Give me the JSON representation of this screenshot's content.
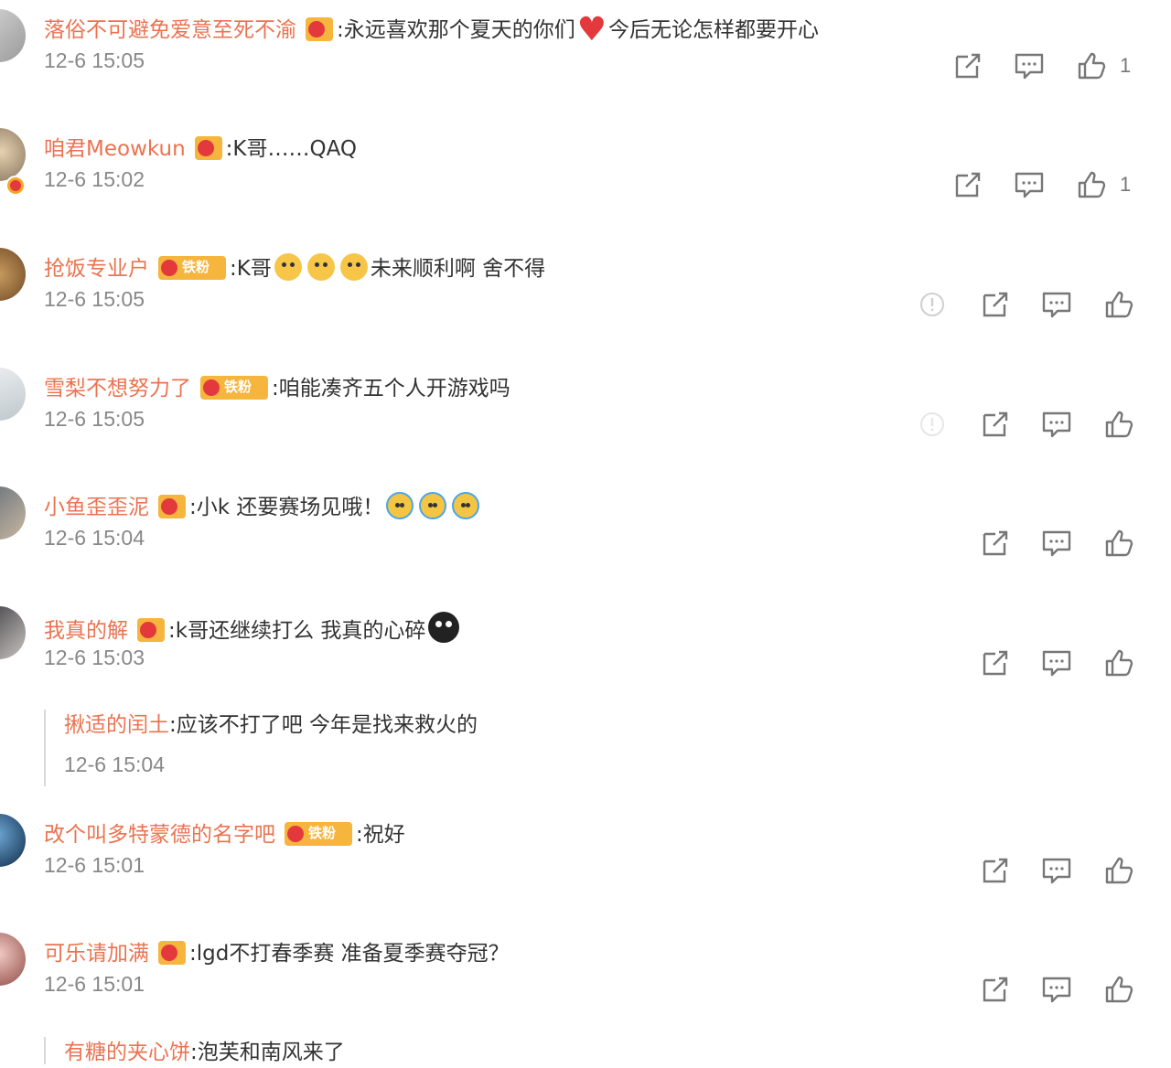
{
  "colors": {
    "username": "#eb7350",
    "text": "#333333",
    "timestamp": "#888888",
    "icon": "#777777",
    "badge": "#f6b53d"
  },
  "badges": {
    "fan_badge_text": "铁粉"
  },
  "comments": [
    {
      "username": "落俗不可避免爱意至死不渝",
      "text_before": ":永远喜欢那个夏天的你们",
      "text_after": "今后无论怎样都要开心",
      "time": "12-6 15:05",
      "likes": "1",
      "badge": "small",
      "icons": [
        "share-icon",
        "comment-icon",
        "like-icon"
      ]
    },
    {
      "username": "咱君Meowkun",
      "text_before": ":K哥……QAQ",
      "time": "12-6 15:02",
      "likes": "1",
      "badge": "small",
      "verified": true,
      "icons": [
        "share-icon",
        "comment-icon",
        "like-icon"
      ]
    },
    {
      "username": "抢饭专业户",
      "text_before": ":K哥",
      "text_after": "未来顺利啊 舍不得",
      "time": "12-6 15:05",
      "badge": "big",
      "icons": [
        "report-icon",
        "share-icon",
        "comment-icon",
        "like-icon"
      ]
    },
    {
      "username": "雪梨不想努力了",
      "text_before": ":咱能凑齐五个人开游戏吗",
      "time": "12-6 15:05",
      "badge": "big",
      "icons": [
        "report-icon",
        "share-icon",
        "comment-icon",
        "like-icon"
      ]
    },
    {
      "username": "小鱼歪歪泥",
      "text_before": ":小k 还要赛场见哦！",
      "time": "12-6 15:04",
      "badge": "small",
      "icons": [
        "share-icon",
        "comment-icon",
        "like-icon"
      ]
    },
    {
      "username": "我真的解",
      "text_before": ":k哥还继续打么 我真的心碎",
      "time": "12-6 15:03",
      "badge": "small",
      "icons": [
        "share-icon",
        "comment-icon",
        "like-icon"
      ],
      "reply": {
        "username": "揪适的闰土",
        "text": ":应该不打了吧 今年是找来救火的",
        "time": "12-6 15:04"
      }
    },
    {
      "username": "改个叫多特蒙德的名字吧",
      "text_before": ":祝好",
      "time": "12-6 15:01",
      "badge": "big",
      "icons": [
        "share-icon",
        "comment-icon",
        "like-icon"
      ]
    },
    {
      "username": "可乐请加满",
      "text_before": ":lgd不打春季赛 准备夏季赛夺冠？",
      "time": "12-6 15:01",
      "badge": "small",
      "icons": [
        "share-icon",
        "comment-icon",
        "like-icon"
      ],
      "reply": {
        "username": "有糖的夹心饼",
        "text": ":泡芙和南风来了",
        "time": ""
      }
    }
  ]
}
